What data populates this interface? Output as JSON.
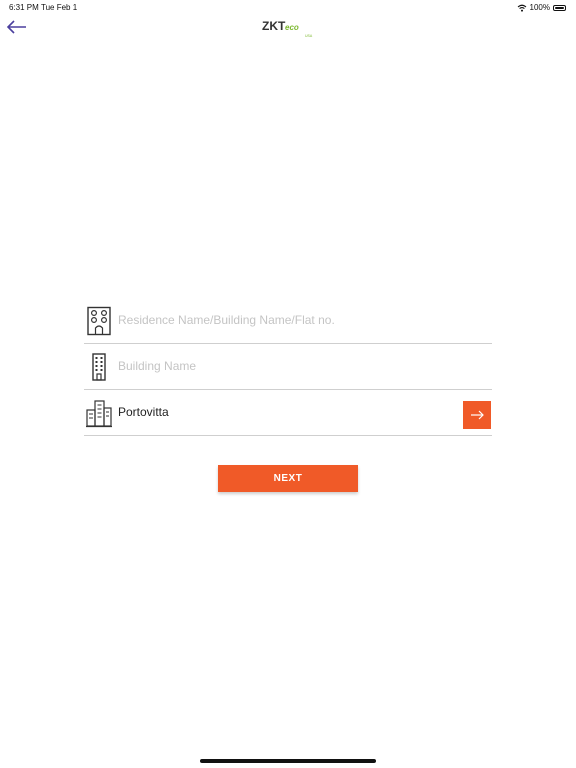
{
  "status_bar": {
    "time": "6:31 PM",
    "date": "Tue Feb 1",
    "battery": "100%"
  },
  "header": {
    "logo_text": "ZKTeco",
    "logo_sub": "USA"
  },
  "form": {
    "residence_placeholder": "Residence Name/Building Name/Flat no.",
    "building_placeholder": "Building Name",
    "community_value": "Portovitta"
  },
  "actions": {
    "next_label": "NEXT"
  },
  "colors": {
    "accent": "#f05a28",
    "back_arrow": "#4b3f9e",
    "logo_green": "#7cb82f"
  }
}
